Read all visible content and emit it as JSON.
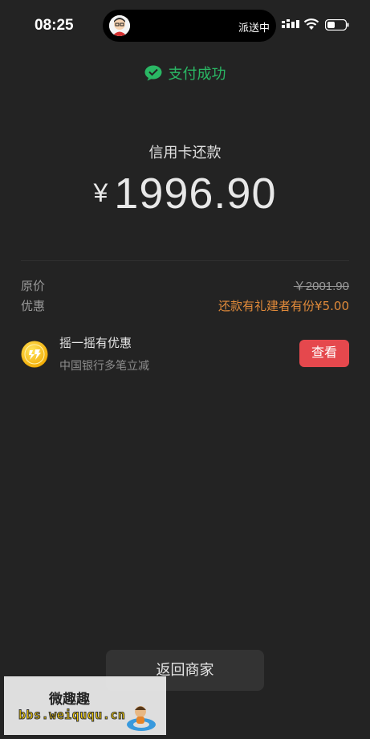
{
  "status_bar": {
    "time": "08:25",
    "island_text": "派送中",
    "icons": [
      "avatar-icon",
      "signal-icon",
      "wifi-icon",
      "battery-icon"
    ]
  },
  "header": {
    "pay_status": "支付成功",
    "icon": "wechat-pay-icon",
    "accent_color": "#2ab764"
  },
  "payment": {
    "merchant": "信用卡还款",
    "currency_symbol": "¥",
    "amount": "1996.90"
  },
  "details": {
    "original_price_label": "原价",
    "original_price_value": "￥2001.90",
    "discount_label": "优惠",
    "discount_value": "还款有礼建者有份¥5.00",
    "discount_color": "#e08a3a"
  },
  "promo": {
    "icon": "gold-coin-icon",
    "title": "摇一摇有优惠",
    "subtitle": "中国银行多笔立减",
    "button_label": "查看",
    "button_color": "#e5484d"
  },
  "footer": {
    "back_button_label": "返回商家"
  },
  "watermark": {
    "title": "微趣趣",
    "url": "bbs.weiququ.cn",
    "icon": "mascot-icon"
  }
}
